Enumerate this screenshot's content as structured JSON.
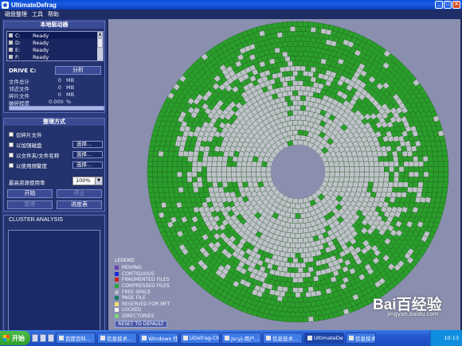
{
  "window": {
    "title": "UltimateDefrag"
  },
  "menu": [
    "磁盘整理",
    "工具",
    "帮助"
  ],
  "drives_panel": {
    "title": "本地驱动器",
    "drives": [
      {
        "letter": "C:",
        "status": "Ready"
      },
      {
        "letter": "D:",
        "status": "Ready"
      },
      {
        "letter": "E:",
        "status": "Ready"
      },
      {
        "letter": "F:",
        "status": "Ready"
      }
    ],
    "drive_label": "DRIVE C:",
    "analyze_label": "分析",
    "stats": [
      {
        "label": "文件总计",
        "value": "0",
        "unit": "MB"
      },
      {
        "label": "邻近文件",
        "value": "0",
        "unit": "MB"
      },
      {
        "label": "碎片文件",
        "value": "0",
        "unit": "MB"
      },
      {
        "label": "破碎程度",
        "value": "0.000",
        "unit": "%"
      }
    ]
  },
  "mode_panel": {
    "title": "整理方式",
    "options": [
      {
        "label": "仅碎片文件",
        "browse": ""
      },
      {
        "label": "以加强磁盘",
        "browse": "选择..."
      },
      {
        "label": "以文件夹/文件名称",
        "browse": "选择..."
      },
      {
        "label": "以使用频繁度",
        "browse": "选择..."
      }
    ],
    "cpu_label": "最高资源使用率",
    "cpu_value": "100%",
    "buttons": {
      "start": "开始",
      "stop": "停止",
      "pause": "暂停",
      "progress": "进度表"
    }
  },
  "cluster": {
    "title": "CLUSTER ANALYSIS"
  },
  "legend": {
    "title": "LEGEND",
    "items": [
      {
        "label": "MOVING",
        "color": "#6a3fb5"
      },
      {
        "label": "CONTIGUOUS",
        "color": "#1a2ad0"
      },
      {
        "label": "FRAGMENTED FILES",
        "color": "#d02020"
      },
      {
        "label": "COMPRESSED FILES",
        "color": "#2fa83a"
      },
      {
        "label": "FREE SPACE",
        "color": "#b7bac8"
      },
      {
        "label": "PAGE FILE",
        "color": "#1b7c6a"
      },
      {
        "label": "RESERVED FOR MFT",
        "color": "#f0e070"
      },
      {
        "label": "LOCKED",
        "color": "#f2f2f2"
      },
      {
        "label": "DIRECTORIES",
        "color": "#7fd37a"
      }
    ],
    "reset_label": "RESET TO DEFAULT"
  },
  "taskbar": {
    "start_label": "开始",
    "tasks": [
      {
        "label": "百度百科..."
      },
      {
        "label": "信息技术..."
      },
      {
        "label": "Windows 任..."
      },
      {
        "label": "UDefrag-CN..."
      },
      {
        "label": "jscyj-用户..."
      },
      {
        "label": "信息技术..."
      },
      {
        "label": "UltimateDef..."
      },
      {
        "label": "信息技术..."
      }
    ],
    "clock": "10:13"
  },
  "watermark": {
    "brand": "Bai百经验",
    "url": "jingyan.baidu.com"
  },
  "colors": {
    "used": "#2a9e2a",
    "free": "#bfc2c9",
    "grid": "#1f5a1f"
  }
}
